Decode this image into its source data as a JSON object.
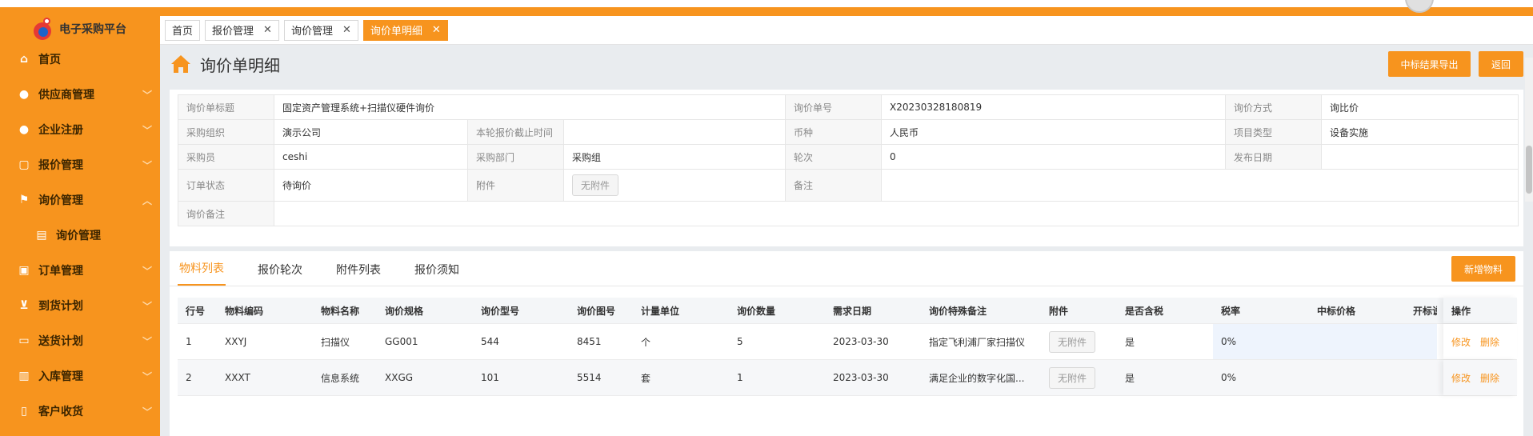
{
  "app": {
    "title": "电子采购平台"
  },
  "sidebar": {
    "items": [
      {
        "label": "首页",
        "icon": "home-icon"
      },
      {
        "label": "供应商管理",
        "icon": "user-icon"
      },
      {
        "label": "企业注册",
        "icon": "user-add-icon"
      },
      {
        "label": "报价管理",
        "icon": "document-icon"
      },
      {
        "label": "询价管理",
        "icon": "flag-icon"
      },
      {
        "label": "询价管理",
        "icon": "list-icon"
      },
      {
        "label": "订单管理",
        "icon": "order-icon"
      },
      {
        "label": "到货计划",
        "icon": "cart-icon"
      },
      {
        "label": "送货计划",
        "icon": "truck-icon"
      },
      {
        "label": "入库管理",
        "icon": "inbox-icon"
      },
      {
        "label": "客户收货",
        "icon": "receipt-icon"
      }
    ]
  },
  "tabs": [
    {
      "label": "首页"
    },
    {
      "label": "报价管理"
    },
    {
      "label": "询价管理"
    },
    {
      "label": "询价单明细"
    }
  ],
  "page": {
    "title": "询价单明细"
  },
  "buttons": {
    "export": "中标结果导出",
    "back": "返回",
    "add_material": "新增物料"
  },
  "info": {
    "title_k": "询价单标题",
    "title_v": "固定资产管理系统+扫描仪硬件询价",
    "no_k": "询价单号",
    "no_v": "X20230328180819",
    "method_k": "询价方式",
    "method_v": "询比价",
    "org_k": "采购组织",
    "org_v": "演示公司",
    "deadline_k": "本轮报价截止时间",
    "deadline_v": "",
    "currency_k": "币种",
    "currency_v": "人民币",
    "ptype_k": "项目类型",
    "ptype_v": "设备实施",
    "buyer_k": "采购员",
    "buyer_v": "ceshi",
    "dept_k": "采购部门",
    "dept_v": "采购组",
    "round_k": "轮次",
    "round_v": "0",
    "pubdate_k": "发布日期",
    "pubdate_v": "",
    "status_k": "订单状态",
    "status_v": "待询价",
    "attach_k": "附件",
    "attach_v": "无附件",
    "remark_k": "备注",
    "remark_v": "",
    "note_k": "询价备注",
    "note_v": ""
  },
  "subtabs": [
    {
      "label": "物料列表"
    },
    {
      "label": "报价轮次"
    },
    {
      "label": "附件列表"
    },
    {
      "label": "报价须知"
    }
  ],
  "table": {
    "headers": [
      "行号",
      "物料编码",
      "物料名称",
      "询价规格",
      "询价型号",
      "询价图号",
      "计量单位",
      "询价数量",
      "需求日期",
      "询价特殊备注",
      "附件",
      "是否含税",
      "税率",
      "中标价格",
      "开标说",
      "操作"
    ],
    "rows": [
      {
        "no": "1",
        "code": "XXYJ",
        "name": "扫描仪",
        "spec": "GG001",
        "model": "544",
        "drawing": "8451",
        "unit": "个",
        "qty": "5",
        "date": "2023-03-30",
        "remark": "指定飞利浦厂家扫描仪",
        "attach": "无附件",
        "tax": "是",
        "rate": "0%",
        "price": "",
        "note": "",
        "edit": "修改",
        "del": "删除"
      },
      {
        "no": "2",
        "code": "XXXT",
        "name": "信息系统",
        "spec": "XXGG",
        "model": "101",
        "drawing": "5514",
        "unit": "套",
        "qty": "1",
        "date": "2023-03-30",
        "remark": "满足企业的数字化国...",
        "attach": "无附件",
        "tax": "是",
        "rate": "0%",
        "price": "",
        "note": "",
        "edit": "修改",
        "del": "删除"
      }
    ]
  },
  "colors": {
    "accent": "#f7941e"
  }
}
